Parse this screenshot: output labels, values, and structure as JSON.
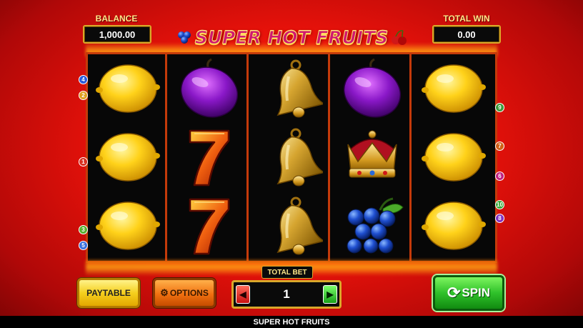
{
  "header": {
    "balance_label": "BALANCE",
    "balance_value": "1,000.00",
    "total_win_label": "TOTAL WIN",
    "total_win_value": "0.00",
    "logo_text": "SUPER HOT FRUITS"
  },
  "reels": [
    [
      "lemon",
      "lemon",
      "lemon"
    ],
    [
      "plum",
      "seven",
      "seven"
    ],
    [
      "bell",
      "bell",
      "bell"
    ],
    [
      "plum",
      "crown",
      "grapes"
    ],
    [
      "lemon",
      "lemon",
      "lemon"
    ]
  ],
  "paylines": {
    "left": [
      {
        "label": "4",
        "color": "#2a5bd8"
      },
      {
        "label": "2",
        "color": "#e0a020"
      },
      {
        "label": "1",
        "color": "#d83020"
      },
      {
        "label": "3",
        "color": "#58b030"
      },
      {
        "label": "5",
        "color": "#3a70e0"
      }
    ],
    "right": [
      {
        "label": "9",
        "color": "#3a9a3a"
      },
      {
        "label": "7",
        "color": "#d06018"
      },
      {
        "label": "6",
        "color": "#c02080"
      },
      {
        "label": "10",
        "color": "#38a838"
      },
      {
        "label": "8",
        "color": "#8030c0"
      }
    ]
  },
  "controls": {
    "paytable_label": "PAYTABLE",
    "options_label": "OPTIONS",
    "total_bet_label": "TOTAL BET",
    "bet_value": "1",
    "bet_decrease_icon": "◀",
    "bet_increase_icon": "▶",
    "spin_label": "SPIN"
  },
  "footer": {
    "title": "SUPER HOT FRUITS"
  },
  "colors": {
    "background": "#e8120a",
    "reel_border": "#c43a0a",
    "gold": "#d9a82a",
    "spin_green": "#2fc12a"
  }
}
